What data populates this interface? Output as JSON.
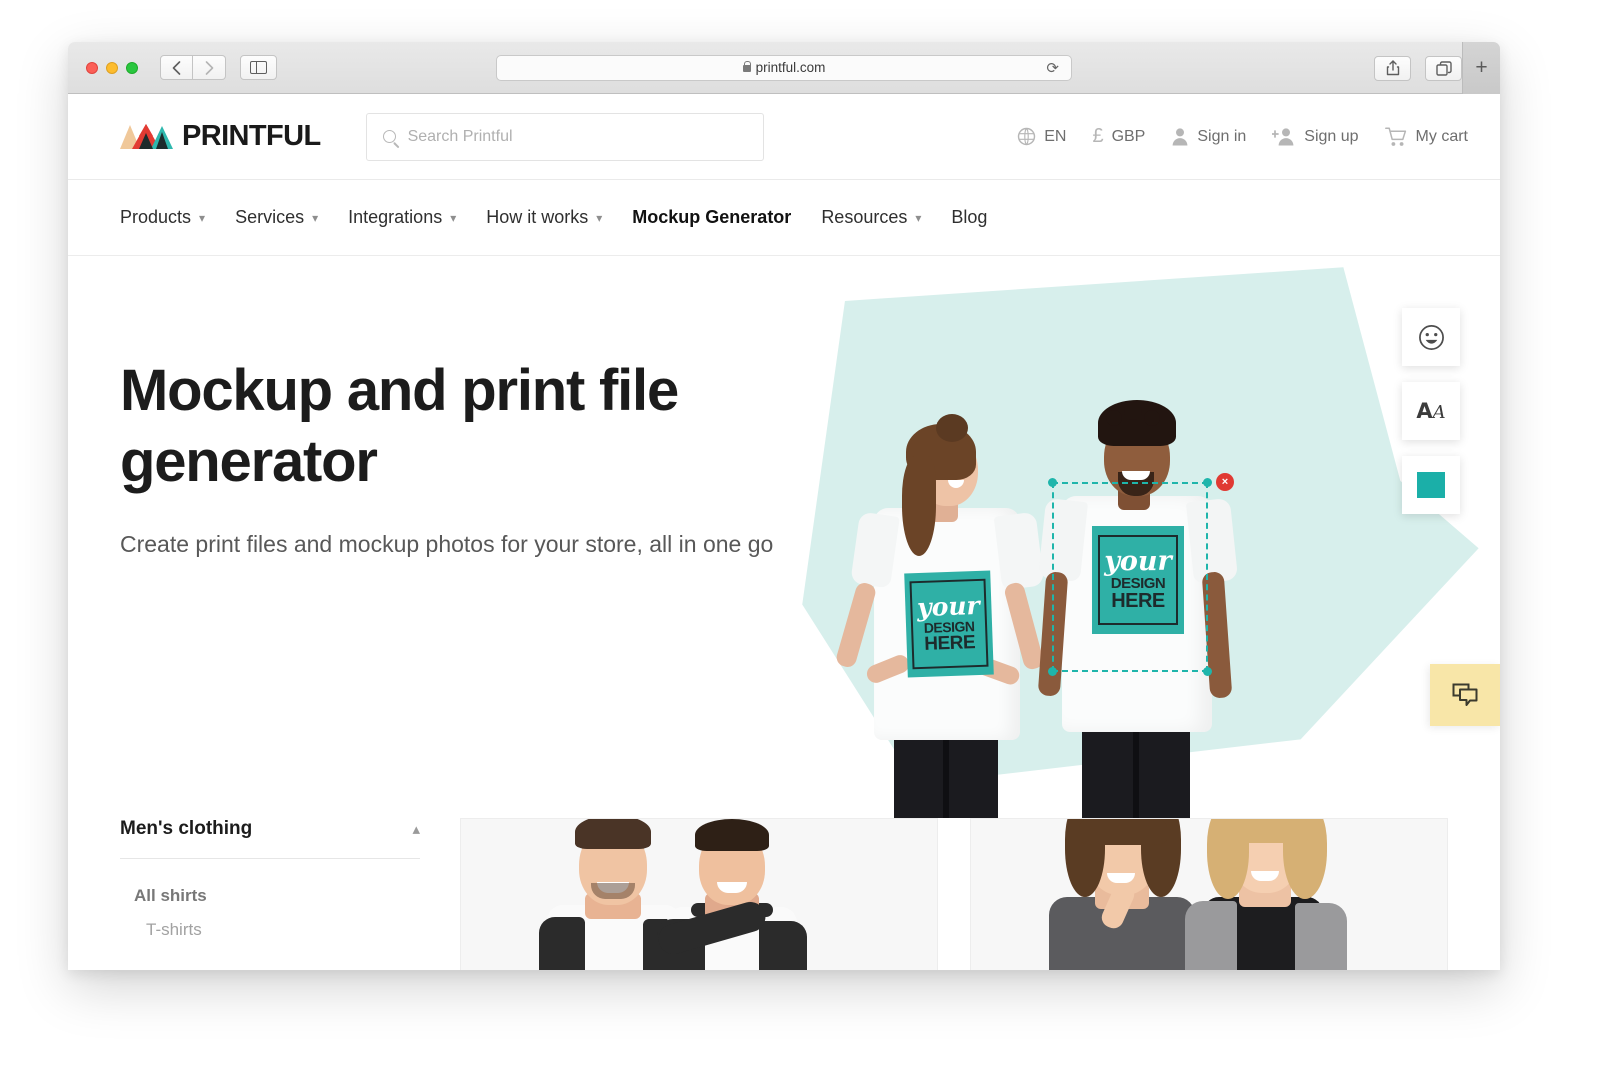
{
  "browser": {
    "url": "printful.com",
    "lock_icon": "lock-icon",
    "back_icon": "chevron-left-icon",
    "forward_icon": "chevron-right-icon",
    "sidebar_icon": "sidebar-toggle-icon",
    "reload_icon": "reload-icon",
    "share_icon": "share-icon",
    "tabs_icon": "show-tabs-icon",
    "newtab_label": "+"
  },
  "header": {
    "brand": "PRINTFUL",
    "search": {
      "placeholder": "Search Printful",
      "value": "",
      "icon": "search-icon"
    },
    "actions": [
      {
        "label": "EN",
        "icon": "globe-icon"
      },
      {
        "label": "GBP",
        "icon": "pound-sterling-icon"
      },
      {
        "label": "Sign in",
        "icon": "person-icon"
      },
      {
        "label": "Sign up",
        "icon": "person-add-icon"
      },
      {
        "label": "My cart",
        "icon": "shopping-cart-icon"
      }
    ]
  },
  "nav": {
    "items": [
      {
        "label": "Products",
        "has_caret": true,
        "active": false
      },
      {
        "label": "Services",
        "has_caret": true,
        "active": false
      },
      {
        "label": "Integrations",
        "has_caret": true,
        "active": false
      },
      {
        "label": "How it works",
        "has_caret": true,
        "active": false
      },
      {
        "label": "Mockup Generator",
        "has_caret": false,
        "active": true
      },
      {
        "label": "Resources",
        "has_caret": true,
        "active": false
      },
      {
        "label": "Blog",
        "has_caret": false,
        "active": false
      }
    ],
    "caret_glyph": "⌄"
  },
  "hero": {
    "title": "Mockup and print file generator",
    "subtitle": "Create print files and mockup photos for your store, all in one go",
    "artwork": {
      "line1": "your",
      "line2": "DESIGN",
      "line3": "HERE"
    },
    "delete_glyph": "×",
    "tools": [
      {
        "name": "emoji-tool",
        "icon": "smiley-face-icon",
        "glyph": "☺"
      },
      {
        "name": "text-tool",
        "icon": "text-aa-icon",
        "glyph": "AA"
      },
      {
        "name": "color-tool",
        "icon": "color-swatch-icon",
        "glyph": ""
      }
    ]
  },
  "chat": {
    "icon": "chat-bubble-icon"
  },
  "categories": {
    "title": "Men's clothing",
    "collapse_icon": "chevron-up-icon",
    "collapse_glyph": "⌃",
    "items": [
      {
        "label": "All shirts",
        "level": "bold"
      },
      {
        "label": "T-shirts",
        "level": "sub"
      }
    ]
  },
  "product_cards": [
    {
      "name": "mens-raglan-card"
    },
    {
      "name": "womens-tee-card"
    }
  ],
  "colors": {
    "teal": "#1bafa8",
    "teal_light": "#d7efec",
    "art_teal": "#2fb0a6",
    "logo_tan": "#f0c89a",
    "logo_red": "#e23b33",
    "logo_teal": "#2fb8ae",
    "chat_yellow": "#f8e6a8",
    "delete_red": "#e03a33"
  }
}
